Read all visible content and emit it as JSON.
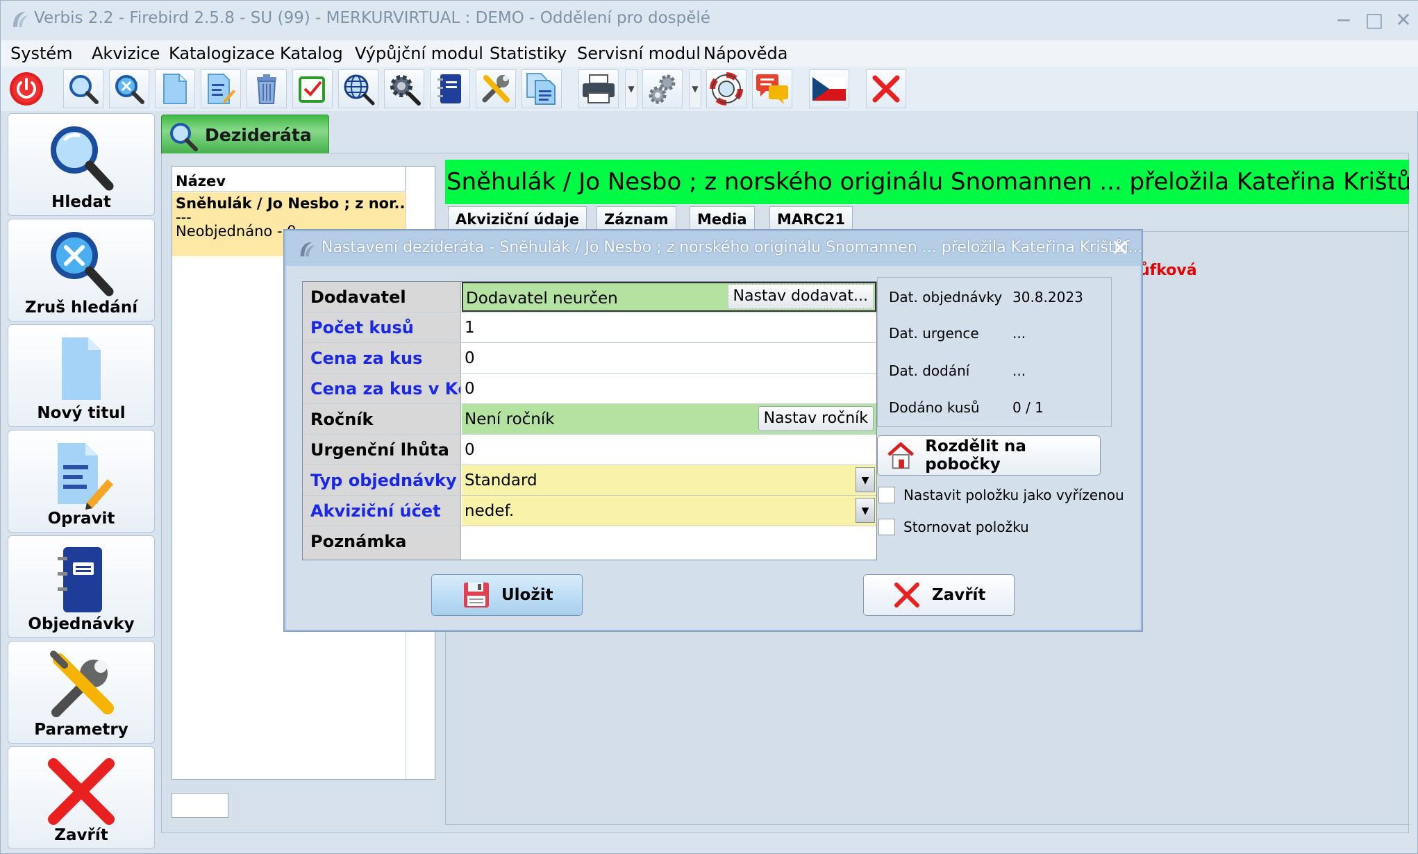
{
  "window": {
    "title": "Verbis 2.2 - Firebird 2.5.8 - SU (99) - MERKURVIRTUAL : DEMO - Oddělení pro dospělé",
    "minimize": "−",
    "maximize": "□",
    "close": "✕"
  },
  "menu": [
    "Systém",
    "Akvizice",
    "Katalogizace",
    "Katalog",
    "Výpůjční modul",
    "Statistiky",
    "Servisní modul",
    "Nápověda"
  ],
  "sidebar": {
    "items": [
      {
        "label": "Hledat",
        "icon": "search-icon"
      },
      {
        "label": "Zruš hledání",
        "icon": "cancel-search-icon"
      },
      {
        "label": "Nový titul",
        "icon": "new-document-icon"
      },
      {
        "label": "Opravit",
        "icon": "edit-document-icon"
      },
      {
        "label": "Objednávky",
        "icon": "notebook-icon"
      },
      {
        "label": "Parametry",
        "icon": "tools-icon"
      },
      {
        "label": "Zavřít",
        "icon": "close-icon"
      }
    ]
  },
  "tab": {
    "label": "Dezideráta"
  },
  "list": {
    "header": "Název",
    "rows": [
      {
        "line1": "Sněhulák / Jo Nesbo ; z nor...",
        "line2": "---",
        "line3": "Neobjednáno - 0"
      }
    ]
  },
  "record": {
    "title": "Sněhulák / Jo Nesbo ; z norského originálu Snomannen ... přeložila Kateřina Krištůfková",
    "tabs": [
      "Akviziční údaje",
      "Záznam",
      "Media",
      "MARC21"
    ],
    "red_text": "ůfková"
  },
  "dialog": {
    "title": "Nastavení dezideráta - Sněhulák / Jo Nesbo ; z norského originálu Snomannen ... přeložila Kateřina Krištůf...",
    "close": "✕",
    "fields": {
      "dodavatel": {
        "label": "Dodavatel",
        "value": "Dodavatel neurčen",
        "button": "Nastav dodavat..."
      },
      "pocet_kusu": {
        "label": "Počet kusů",
        "value": "1"
      },
      "cena_za_kus": {
        "label": "Cena za kus",
        "value": "0"
      },
      "cena_za_kus_kc": {
        "label": "Cena za kus v Kč",
        "value": "0"
      },
      "rocnik": {
        "label": "Ročník",
        "value": "Není ročník",
        "button": "Nastav ročník"
      },
      "urgencni_lhuta": {
        "label": "Urgenční lhůta",
        "value": "0"
      },
      "typ_objednavky": {
        "label": "Typ objednávky",
        "value": "Standard"
      },
      "akvizicni_ucet": {
        "label": "Akviziční účet",
        "value": "nedef."
      },
      "poznamka": {
        "label": "Poznámka",
        "value": ""
      }
    },
    "info": {
      "dat_objednavky": {
        "label": "Dat. objednávky",
        "value": "30.8.2023"
      },
      "dat_urgence": {
        "label": "Dat. urgence",
        "value": "..."
      },
      "dat_dodani": {
        "label": "Dat. dodání",
        "value": "..."
      },
      "dodano_kusu": {
        "label": "Dodáno kusů",
        "value": "0 / 1"
      }
    },
    "split_button": "Rozdělit na pobočky",
    "checkbox_vyrizena": "Nastavit položku jako vyřízenou",
    "checkbox_storno": "Stornovat položku",
    "save_button": "Uložit",
    "close_button": "Zavřít"
  }
}
